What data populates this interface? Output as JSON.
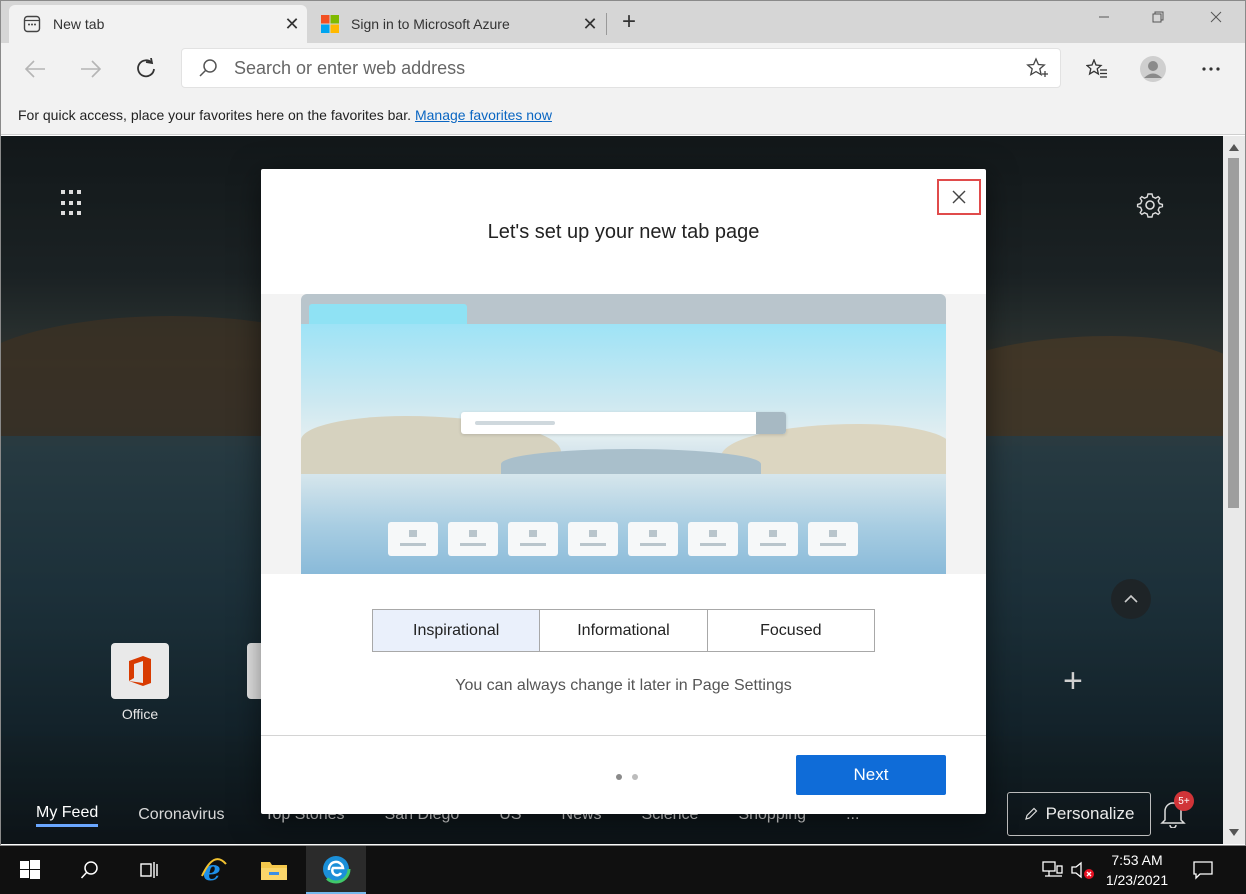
{
  "browser": {
    "tabs": [
      {
        "title": "New tab",
        "active": true
      },
      {
        "title": "Sign in to Microsoft Azure",
        "active": false
      }
    ],
    "address_placeholder": "Search or enter web address",
    "favorites_bar": {
      "text": "For quick access, place your favorites here on the favorites bar.",
      "link": "Manage favorites now"
    }
  },
  "new_tab_page": {
    "quick_links": [
      {
        "label": "Office"
      }
    ],
    "feed_nav": [
      "My Feed",
      "Coronavirus",
      "Top Stories",
      "San Diego",
      "US",
      "News",
      "Science",
      "Shopping"
    ],
    "feed_more": "...",
    "personalize_label": "Personalize",
    "notification_badge": "5+"
  },
  "dialog": {
    "title": "Let's set up your new tab page",
    "layout_options": [
      "Inspirational",
      "Informational",
      "Focused"
    ],
    "selected_option": "Inspirational",
    "hint": "You can always change it later in Page Settings",
    "next_label": "Next",
    "step_count": 2,
    "current_step": 1
  },
  "taskbar": {
    "time": "7:53 AM",
    "date": "1/23/2021"
  },
  "colors": {
    "accent": "#0f6cd8",
    "highlight_box": "#e04b4b",
    "link": "#0a66c2"
  }
}
